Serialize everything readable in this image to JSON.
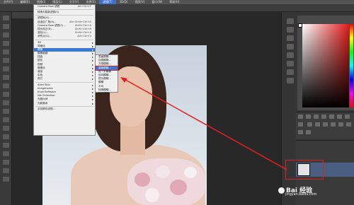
{
  "menubar": {
    "items": [
      "文件(F)",
      "编辑(E)",
      "图像(I)",
      "图层(L)",
      "文字(Y)",
      "选择(S)",
      "滤镜(T)",
      "3D(D)",
      "视图(V)",
      "窗口(W)",
      "帮助(H)"
    ],
    "active_index": 6
  },
  "doc_tab": {
    "title": ""
  },
  "filter_menu": {
    "items": [
      {
        "label": "Camera Raw 滤镜",
        "shortcut": "Alt+Ctrl+F"
      },
      {
        "sep": true
      },
      {
        "label": "转换为智能滤镜(S)",
        "shortcut": ""
      },
      {
        "sep": true
      },
      {
        "label": "滤镜库(G)...",
        "shortcut": ""
      },
      {
        "label": "自适应广角(A)...",
        "shortcut": "Alt+Shift+Ctrl+A"
      },
      {
        "label": "Camera Raw 滤镜(C)...",
        "shortcut": "Shift+Ctrl+A"
      },
      {
        "label": "镜头校正(R)...",
        "shortcut": "Shift+Ctrl+R"
      },
      {
        "label": "液化(L)...",
        "shortcut": "Shift+Ctrl+X"
      },
      {
        "label": "消失点(V)...",
        "shortcut": "Alt+Ctrl+V"
      },
      {
        "sep": true
      },
      {
        "label": "3D",
        "arrow": true
      },
      {
        "label": "风格化",
        "arrow": true
      },
      {
        "label": "模糊",
        "arrow": true,
        "highlight": true
      },
      {
        "label": "模糊画廊",
        "arrow": true
      },
      {
        "label": "扭曲",
        "arrow": true
      },
      {
        "label": "锐化",
        "arrow": true
      },
      {
        "label": "视频",
        "arrow": true
      },
      {
        "label": "像素化",
        "arrow": true
      },
      {
        "label": "渲染",
        "arrow": true
      },
      {
        "label": "杂色",
        "arrow": true
      },
      {
        "label": "其它",
        "arrow": true
      },
      {
        "sep": true
      },
      {
        "label": "Alien Skin",
        "arrow": true
      },
      {
        "label": "Imagenomic",
        "arrow": true
      },
      {
        "label": "Knoll Software",
        "arrow": true
      },
      {
        "label": "Nik Collection",
        "arrow": true
      },
      {
        "label": "光圈大师",
        "arrow": true
      },
      {
        "label": "光影魔术",
        "arrow": true
      },
      {
        "sep": true
      },
      {
        "label": "浏览联机滤镜...",
        "shortcut": ""
      }
    ]
  },
  "blur_submenu": {
    "items": [
      {
        "label": "表面模糊..."
      },
      {
        "label": "动感模糊..."
      },
      {
        "label": "方框模糊..."
      },
      {
        "label": "高斯模糊...",
        "highlight": true
      },
      {
        "label": "进一步模糊"
      },
      {
        "label": "径向模糊..."
      },
      {
        "label": "镜头模糊..."
      },
      {
        "label": "模糊"
      },
      {
        "label": "平均"
      },
      {
        "label": "特殊模糊..."
      },
      {
        "label": "形状模糊..."
      }
    ]
  },
  "watermark": {
    "text": "Bai 经验",
    "url": "jingyan.baidu.com"
  },
  "colors": {
    "accent": "#3a77d9",
    "annotation": "#e02020"
  }
}
